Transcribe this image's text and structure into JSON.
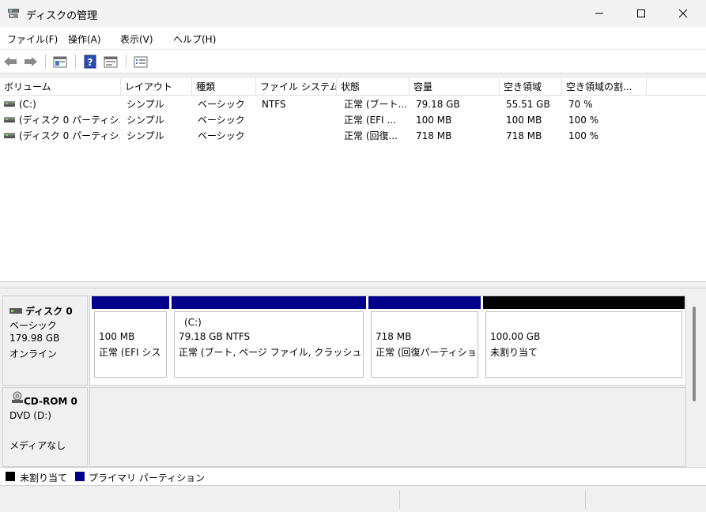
{
  "window": {
    "title": "ディスクの管理"
  },
  "menu": {
    "items": [
      "ファイル(F)",
      "操作(A)",
      "表示(V)",
      "ヘルプ(H)"
    ]
  },
  "toolbar": {
    "icons": [
      "back-arrow-icon",
      "forward-arrow-icon",
      "disk-list-icon",
      "help-icon",
      "properties-icon",
      "settings-list-icon"
    ]
  },
  "volumes": {
    "columns": [
      "ボリューム",
      "レイアウト",
      "種類",
      "ファイル システム",
      "状態",
      "容量",
      "空き領域",
      "空き領域の割..."
    ],
    "rows": [
      [
        "(C:)",
        "シンプル",
        "ベーシック",
        "NTFS",
        "正常 (ブート...",
        "79.18 GB",
        "55.51 GB",
        "70 %"
      ],
      [
        "(ディスク 0 パーティシ...",
        "シンプル",
        "ベーシック",
        "",
        "正常 (EFI ...",
        "100 MB",
        "100 MB",
        "100 %"
      ],
      [
        "(ディスク 0 パーティシ...",
        "シンプル",
        "ベーシック",
        "",
        "正常 (回復...",
        "718 MB",
        "718 MB",
        "100 %"
      ]
    ]
  },
  "disks": {
    "disk0": {
      "name": "ディスク 0",
      "type": "ベーシック",
      "size": "179.98 GB",
      "status": "オンライン",
      "partitions": [
        {
          "title": "",
          "line1": "100 MB",
          "line2": "正常 (EFI シス",
          "kind": "primary"
        },
        {
          "title": "(C:)",
          "line1": "79.18 GB NTFS",
          "line2": "正常 (ブート, ページ ファイル, クラッシュ ダン",
          "kind": "primary"
        },
        {
          "title": "",
          "line1": "718 MB",
          "line2": "正常 (回復パーティショ",
          "kind": "primary"
        },
        {
          "title": "",
          "line1": "100.00 GB",
          "line2": "未割り当て",
          "kind": "unallocated"
        }
      ]
    },
    "cdrom0": {
      "name": "CD-ROM 0",
      "drive": "DVD (D:)",
      "status": "メディアなし"
    }
  },
  "legend": {
    "items": [
      {
        "label": "未割り当て",
        "color": "#000000"
      },
      {
        "label": "プライマリ パーティション",
        "color": "#00008b"
      }
    ]
  },
  "colors": {
    "primary": "#00008b",
    "unallocated": "#000000"
  }
}
